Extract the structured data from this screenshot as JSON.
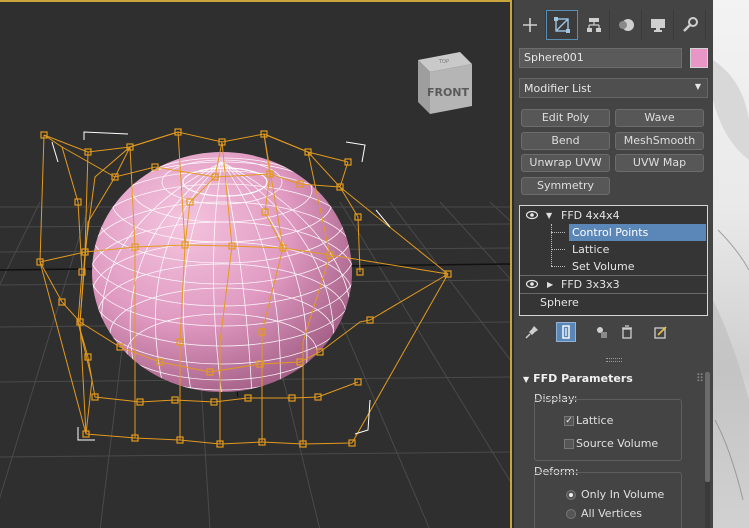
{
  "viewport": {
    "viewcube_top_label": "TOP",
    "viewcube_front_label": "FRONT"
  },
  "panel": {
    "tabs": [
      {
        "name": "create-tab",
        "icon": "plus-icon"
      },
      {
        "name": "modify-tab",
        "icon": "modify-icon"
      },
      {
        "name": "hierarchy-tab",
        "icon": "hierarchy-icon"
      },
      {
        "name": "motion-tab",
        "icon": "motion-icon"
      },
      {
        "name": "display-tab",
        "icon": "display-icon"
      },
      {
        "name": "utilities-tab",
        "icon": "wrench-icon"
      }
    ],
    "object_name": "Sphere001",
    "object_color": "#e896c6",
    "modifier_list": "Modifier List",
    "modifier_buttons": [
      "Edit Poly",
      "Wave",
      "Bend",
      "MeshSmooth",
      "Unwrap UVW",
      "UVW Map",
      "Symmetry"
    ],
    "stack": {
      "ffd4": "FFD 4x4x4",
      "control_points": "Control Points",
      "lattice": "Lattice",
      "set_volume": "Set Volume",
      "ffd3": "FFD 3x3x3",
      "sphere": "Sphere"
    },
    "rollout": {
      "title": "FFD Parameters",
      "display_group": "Display:",
      "lattice_label": "Lattice",
      "lattice_checked": true,
      "source_volume_label": "Source Volume",
      "source_volume_checked": false,
      "deform_group": "Deform:",
      "only_in_volume": "Only In Volume",
      "all_vertices": "All Vertices",
      "deform_selected": "Only In Volume"
    }
  },
  "colors": {
    "accent_selection": "#5b86b8",
    "lattice_orange": "#e39a1e",
    "sphere_pink": "#e2a2c8",
    "viewport_border": "#c9a53c"
  }
}
